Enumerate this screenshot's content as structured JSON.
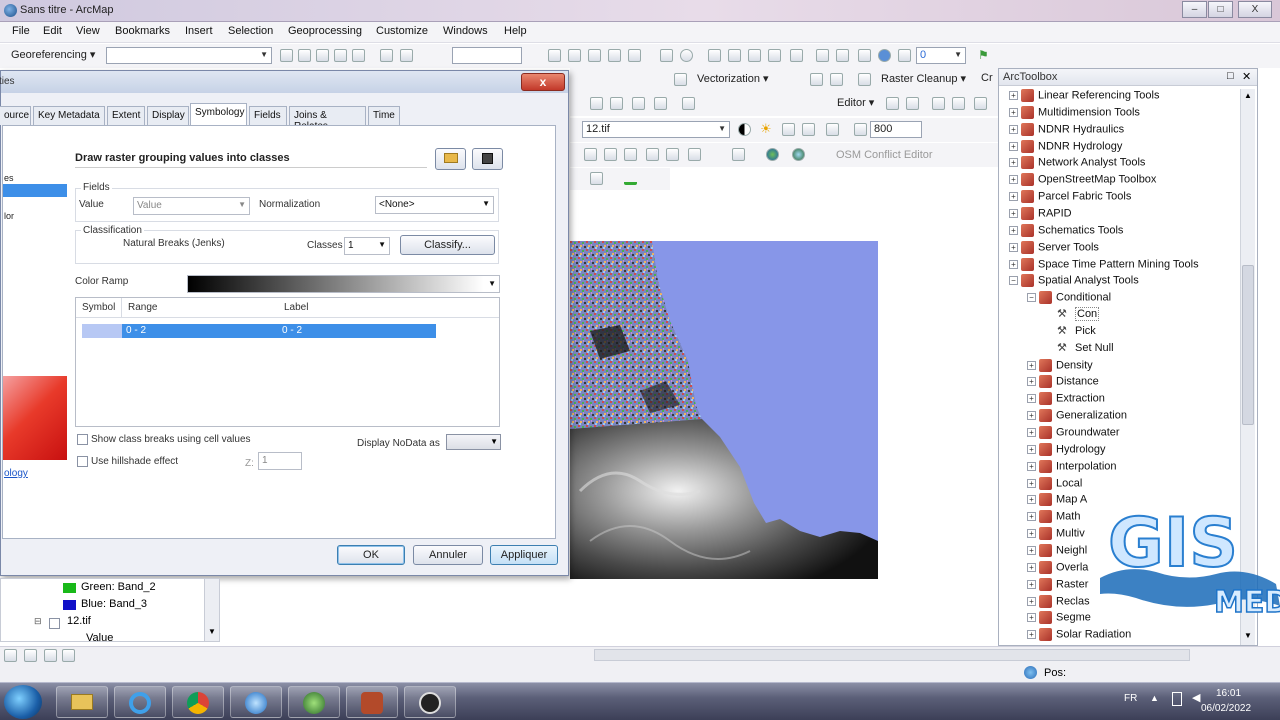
{
  "window": {
    "title": "Sans titre - ArcMap",
    "min": "–",
    "max": "□",
    "close": "X"
  },
  "menu": [
    "File",
    "Edit",
    "View",
    "Bookmarks",
    "Insert",
    "Selection",
    "Geoprocessing",
    "Customize",
    "Windows",
    "Help"
  ],
  "toolbars": {
    "georeferencing": "Georeferencing ▾",
    "vectorization": "Vectorization ▾",
    "raster_cleanup": "Raster Cleanup ▾",
    "cr": "Cr",
    "editor": "Editor ▾",
    "layer_combo": "12.tif",
    "zoom_value": "800",
    "scale_value": "0",
    "osm_editor": "OSM Conflict Editor"
  },
  "dialog": {
    "title_fragment": "ties",
    "close_label": "x",
    "tabs": [
      "ource",
      "Key Metadata",
      "Extent",
      "Display",
      "Symbology",
      "Fields",
      "Joins & Relates",
      "Time"
    ],
    "left_fragments": [
      "es",
      "lor",
      "ology"
    ],
    "heading": "Draw raster grouping values into classes",
    "fields_group": "Fields",
    "value_label": "Value",
    "value_combo": "Value",
    "normalization_label": "Normalization",
    "normalization_combo": "<None>",
    "classification_group": "Classification",
    "method": "Natural Breaks (Jenks)",
    "classes_label": "Classes",
    "classes_value": "1",
    "classify_button": "Classify...",
    "color_ramp_label": "Color Ramp",
    "table_headers": {
      "symbol": "Symbol",
      "range": "Range",
      "label": "Label"
    },
    "table_rows": [
      {
        "range": "0 - 2",
        "label": "0 - 2"
      }
    ],
    "show_breaks": "Show class breaks using cell values",
    "hillshade": "Use hillshade effect",
    "z_label": "Z:",
    "z_value": "1",
    "nodata_label": "Display NoData as",
    "ok": "OK",
    "cancel": "Annuler",
    "apply": "Appliquer"
  },
  "toc": {
    "green": "Green: Band_2",
    "blue": "Blue:  Band_3",
    "layer": "12.tif",
    "value": "Value"
  },
  "toolbox": {
    "title": "ArcToolbox",
    "items": [
      {
        "level": 0,
        "label": "Linear Referencing Tools",
        "exp": "+"
      },
      {
        "level": 0,
        "label": "Multidimension Tools",
        "exp": "+"
      },
      {
        "level": 0,
        "label": "NDNR Hydraulics",
        "exp": "+"
      },
      {
        "level": 0,
        "label": "NDNR Hydrology",
        "exp": "+"
      },
      {
        "level": 0,
        "label": "Network Analyst Tools",
        "exp": "+"
      },
      {
        "level": 0,
        "label": "OpenStreetMap Toolbox",
        "exp": "+"
      },
      {
        "level": 0,
        "label": "Parcel Fabric Tools",
        "exp": "+"
      },
      {
        "level": 0,
        "label": "RAPID",
        "exp": "+"
      },
      {
        "level": 0,
        "label": "Schematics Tools",
        "exp": "+"
      },
      {
        "level": 0,
        "label": "Server Tools",
        "exp": "+"
      },
      {
        "level": 0,
        "label": "Space Time Pattern Mining Tools",
        "exp": "+"
      },
      {
        "level": 0,
        "label": "Spatial Analyst Tools",
        "exp": "−"
      },
      {
        "level": 1,
        "label": "Conditional",
        "exp": "−"
      },
      {
        "level": 2,
        "label": "Con",
        "exp": ""
      },
      {
        "level": 2,
        "label": "Pick",
        "exp": ""
      },
      {
        "level": 2,
        "label": "Set Null",
        "exp": ""
      },
      {
        "level": 1,
        "label": "Density",
        "exp": "+"
      },
      {
        "level": 1,
        "label": "Distance",
        "exp": "+"
      },
      {
        "level": 1,
        "label": "Extraction",
        "exp": "+"
      },
      {
        "level": 1,
        "label": "Generalization",
        "exp": "+"
      },
      {
        "level": 1,
        "label": "Groundwater",
        "exp": "+"
      },
      {
        "level": 1,
        "label": "Hydrology",
        "exp": "+"
      },
      {
        "level": 1,
        "label": "Interpolation",
        "exp": "+"
      },
      {
        "level": 1,
        "label": "Local",
        "exp": "+"
      },
      {
        "level": 1,
        "label": "Map A",
        "exp": "+"
      },
      {
        "level": 1,
        "label": "Math",
        "exp": "+"
      },
      {
        "level": 1,
        "label": "Multiv",
        "exp": "+"
      },
      {
        "level": 1,
        "label": "Neighl",
        "exp": "+"
      },
      {
        "level": 1,
        "label": "Overla",
        "exp": "+"
      },
      {
        "level": 1,
        "label": "Raster",
        "exp": "+"
      },
      {
        "level": 1,
        "label": "Reclas",
        "exp": "+"
      },
      {
        "level": 1,
        "label": "Segme",
        "exp": "+"
      },
      {
        "level": 1,
        "label": "Solar Radiation",
        "exp": "+"
      }
    ]
  },
  "watermark": {
    "big": "GIS",
    "small": "MED"
  },
  "status": {
    "pos": "Pos:"
  },
  "tray": {
    "lang": "FR",
    "time": "16:01",
    "date": "06/02/2022"
  },
  "colors": {
    "selection": "#3d8fe8",
    "map_water": "#8796e8",
    "title_close": "#c2392a"
  }
}
